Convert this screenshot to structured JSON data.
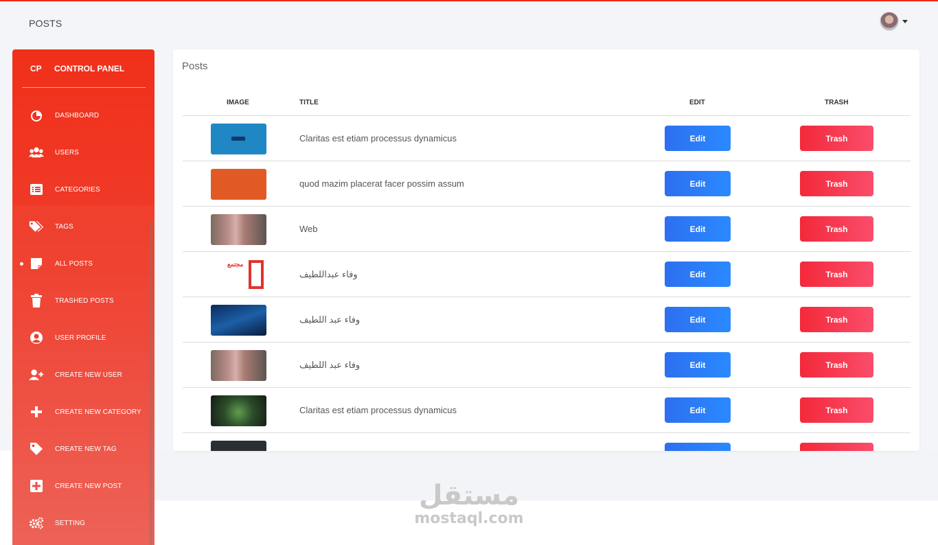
{
  "header": {
    "title": "POSTS"
  },
  "sidebar": {
    "brand_short": "CP",
    "brand_name": "CONTROL PANEL",
    "items": [
      {
        "label": "DASHBOARD",
        "icon": "pie-chart-icon"
      },
      {
        "label": "USERS",
        "icon": "users-icon"
      },
      {
        "label": "CATEGORIES",
        "icon": "list-icon"
      },
      {
        "label": "TAGS",
        "icon": "tags-icon"
      },
      {
        "label": "ALL POSTS",
        "icon": "sticky-note-icon",
        "active": true
      },
      {
        "label": "TRASHED POSTS",
        "icon": "trash-icon"
      },
      {
        "label": "USER PROFILE",
        "icon": "user-circle-icon"
      },
      {
        "label": "CREATE NEW USER",
        "icon": "user-plus-icon"
      },
      {
        "label": "CREATE NEW CATEGORY",
        "icon": "plus-icon"
      },
      {
        "label": "CREATE NEW TAG",
        "icon": "tag-icon"
      },
      {
        "label": "CREATE NEW POST",
        "icon": "plus-square-icon"
      },
      {
        "label": "SETTING",
        "icon": "cogs-icon"
      }
    ]
  },
  "card": {
    "title": "Posts",
    "columns": [
      "IMAGE",
      "TITLE",
      "EDIT",
      "TRASH"
    ],
    "rows": [
      {
        "title": "Claritas est etiam processus dynamicus",
        "thumb": "blue",
        "edit": "Edit",
        "trash": "Trash"
      },
      {
        "title": "quod mazim placerat facer possim assum",
        "thumb": "orange",
        "edit": "Edit",
        "trash": "Trash"
      },
      {
        "title": "Web",
        "thumb": "photo",
        "edit": "Edit",
        "trash": "Trash"
      },
      {
        "title": "وفاء عبداللطيف",
        "thumb": "logo",
        "edit": "Edit",
        "trash": "Trash"
      },
      {
        "title": "وفاء عبد اللطيف",
        "thumb": "win",
        "edit": "Edit",
        "trash": "Trash"
      },
      {
        "title": "وفاء عبد اللطيف",
        "thumb": "photo",
        "edit": "Edit",
        "trash": "Trash"
      },
      {
        "title": "Claritas est etiam processus dynamicus",
        "thumb": "green",
        "edit": "Edit",
        "trash": "Trash"
      },
      {
        "title": "",
        "thumb": "dark",
        "edit": "",
        "trash": ""
      }
    ]
  },
  "thumb_logo_text": "مجتمع",
  "watermark": {
    "arabic": "مستقل",
    "latin": "mostaql.com"
  },
  "colors": {
    "accent": "#f0281a",
    "edit": "#2d6ff0",
    "trash": "#f3293a"
  }
}
